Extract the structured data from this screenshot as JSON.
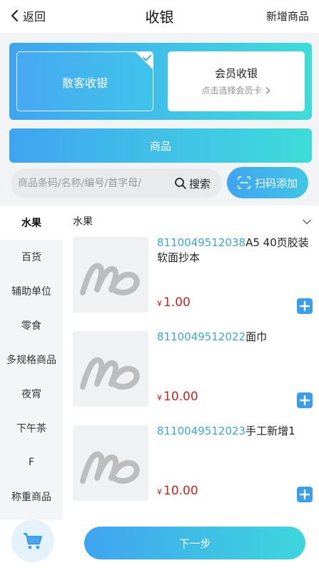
{
  "header": {
    "back_label": "返回",
    "title": "收银",
    "add_goods_label": "新增商品"
  },
  "mode": {
    "guest_label": "散客收银",
    "member_label": "会员收银",
    "member_sub": "点击选择会员卡",
    "selected": "guest"
  },
  "goods_bar": {
    "label": "商品"
  },
  "search": {
    "placeholder": "商品条码/名称/编号/首字母/",
    "button_label": "搜索"
  },
  "scan": {
    "label": "扫码添加"
  },
  "categories": [
    {
      "label": "水果",
      "active": true
    },
    {
      "label": "百货",
      "active": false
    },
    {
      "label": "辅助单位",
      "active": false
    },
    {
      "label": "零食",
      "active": false
    },
    {
      "label": "多规格商品",
      "active": false
    },
    {
      "label": "夜宵",
      "active": false
    },
    {
      "label": "下午茶",
      "active": false
    },
    {
      "label": "F",
      "active": false
    },
    {
      "label": "称重商品",
      "active": false
    }
  ],
  "list": {
    "category_title": "水果",
    "items": [
      {
        "code": "8110049512038",
        "name": "A5 40页胶装软面抄本",
        "currency": "¥",
        "price": "1.00"
      },
      {
        "code": "8110049512022",
        "name": "面巾",
        "currency": "¥",
        "price": "10.00"
      },
      {
        "code": "8110049512023",
        "name": "手工新增1",
        "currency": "¥",
        "price": "10.00"
      }
    ]
  },
  "bottom": {
    "next_label": "下一步"
  },
  "colors": {
    "accent_blue": "#3fa4f0",
    "accent_teal": "#3ddcd8",
    "price_red": "#d02020",
    "code_blue": "#39a6d8"
  }
}
